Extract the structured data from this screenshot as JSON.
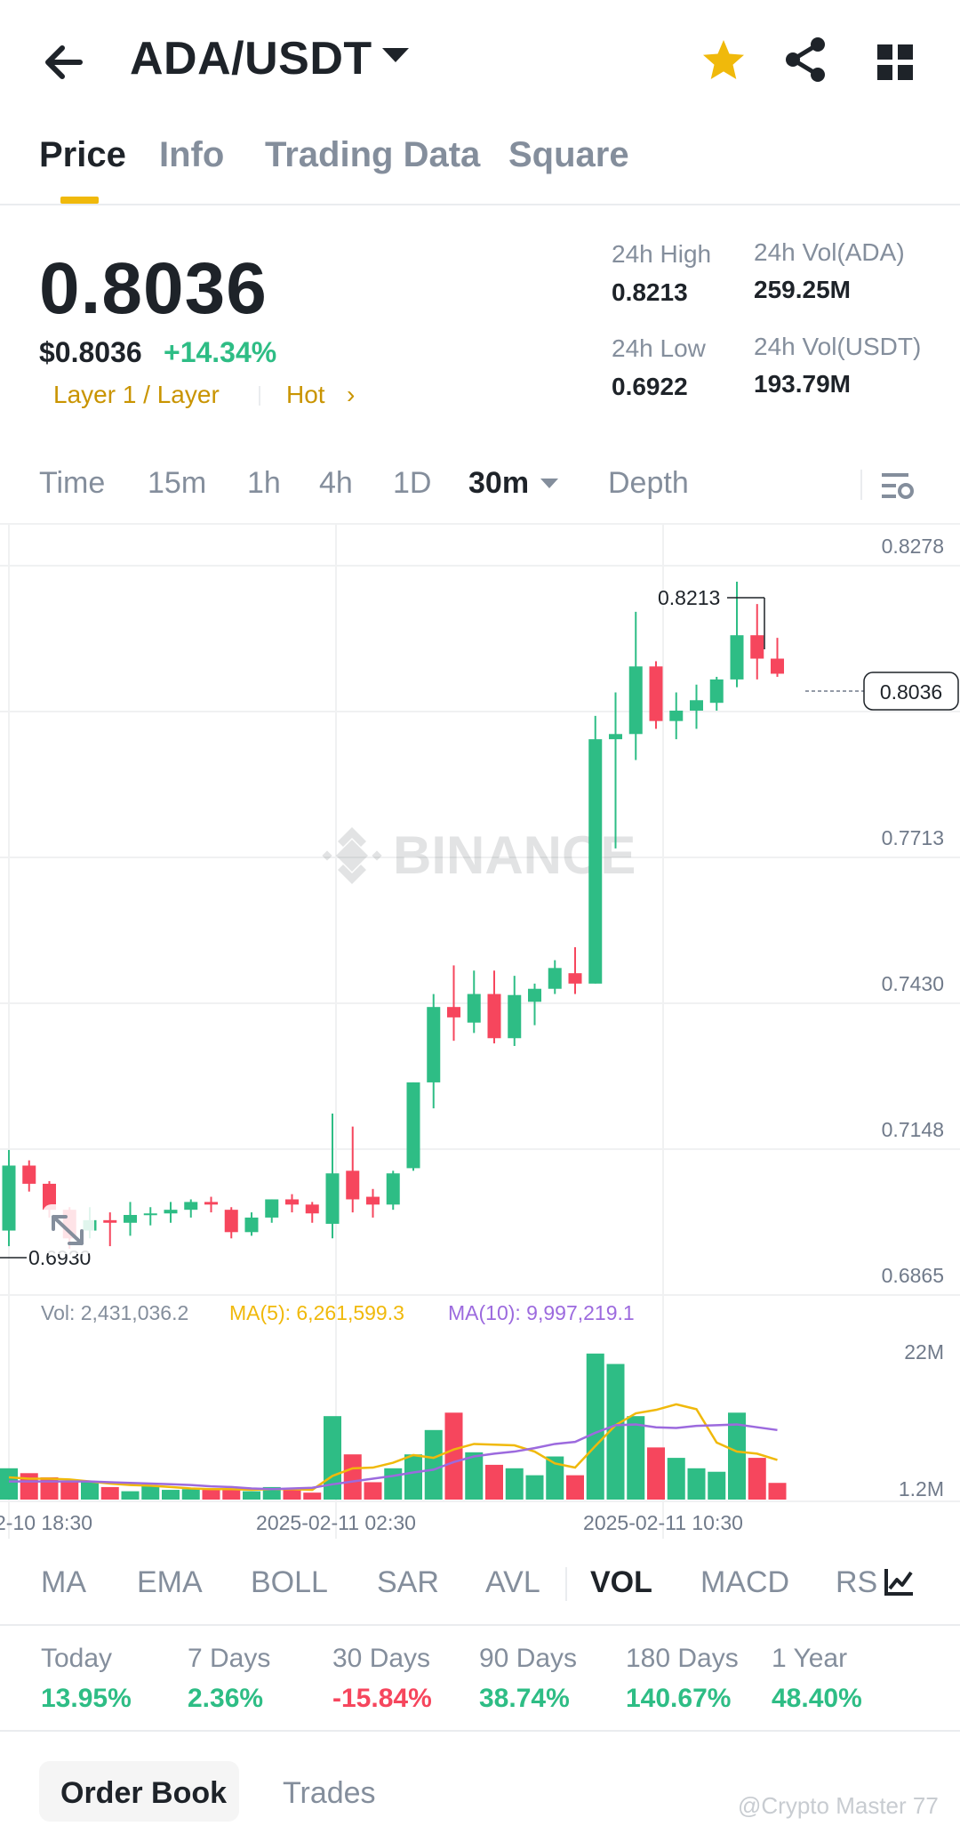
{
  "header": {
    "pair": "ADA/USDT"
  },
  "tabs": [
    "Price",
    "Info",
    "Trading Data",
    "Square"
  ],
  "price": {
    "last": "0.8036",
    "usd": "$0.8036",
    "change": "+14.34%",
    "tag_category": "Layer 1 / Layer",
    "tag_hot": "Hot",
    "tag_arrow": "›"
  },
  "stats": {
    "high_label": "24h High",
    "high": "0.8213",
    "low_label": "24h Low",
    "low": "0.6922",
    "vol_base_label": "24h Vol(ADA)",
    "vol_base": "259.25M",
    "vol_quote_label": "24h Vol(USDT)",
    "vol_quote": "193.79M"
  },
  "intervals": [
    "Time",
    "15m",
    "1h",
    "4h",
    "1D",
    "30m",
    "Depth"
  ],
  "chart": {
    "watermark": "BINANCE",
    "price_axis": [
      "0.8278",
      "0.7713",
      "0.7430",
      "0.7148",
      "0.6865"
    ],
    "current_price_tag": "0.8036",
    "high_marker": "0.8213",
    "low_marker": "0.6930",
    "vol_legend": {
      "vol": "Vol: 2,431,036.2",
      "ma5": "MA(5): 6,261,599.3",
      "ma10": "MA(10): 9,997,219.1"
    },
    "vol_axis": [
      "22M",
      "1.2M"
    ],
    "time_axis": [
      "2-10 18:30",
      "2025-02-11 02:30",
      "2025-02-11 10:30"
    ],
    "colors": {
      "up": "#2ebd85",
      "down": "#f6465d",
      "ma5": "#f0b90b",
      "ma10": "#9c6ade"
    }
  },
  "chart_data": {
    "type": "candlestick",
    "interval": "30m",
    "price_range": [
      0.6865,
      0.8278
    ],
    "candles": [
      {
        "o": 0.6965,
        "h": 0.712,
        "l": 0.6935,
        "c": 0.709
      },
      {
        "o": 0.709,
        "h": 0.71,
        "l": 0.704,
        "c": 0.7055
      },
      {
        "o": 0.7055,
        "h": 0.706,
        "l": 0.699,
        "c": 0.7005
      },
      {
        "o": 0.7005,
        "h": 0.701,
        "l": 0.693,
        "c": 0.695
      },
      {
        "o": 0.6965,
        "h": 0.701,
        "l": 0.695,
        "c": 0.6985
      },
      {
        "o": 0.6985,
        "h": 0.7,
        "l": 0.6935,
        "c": 0.698
      },
      {
        "o": 0.698,
        "h": 0.702,
        "l": 0.6955,
        "c": 0.6995
      },
      {
        "o": 0.6995,
        "h": 0.701,
        "l": 0.6975,
        "c": 0.6998
      },
      {
        "o": 0.6998,
        "h": 0.702,
        "l": 0.698,
        "c": 0.7005
      },
      {
        "o": 0.7005,
        "h": 0.7025,
        "l": 0.699,
        "c": 0.702
      },
      {
        "o": 0.702,
        "h": 0.703,
        "l": 0.7,
        "c": 0.7015
      },
      {
        "o": 0.7005,
        "h": 0.701,
        "l": 0.695,
        "c": 0.6962
      },
      {
        "o": 0.6962,
        "h": 0.7,
        "l": 0.6955,
        "c": 0.699
      },
      {
        "o": 0.699,
        "h": 0.7025,
        "l": 0.698,
        "c": 0.7025
      },
      {
        "o": 0.7025,
        "h": 0.7035,
        "l": 0.7,
        "c": 0.7015
      },
      {
        "o": 0.7015,
        "h": 0.702,
        "l": 0.698,
        "c": 0.6998
      },
      {
        "o": 0.6978,
        "h": 0.719,
        "l": 0.695,
        "c": 0.7075
      },
      {
        "o": 0.708,
        "h": 0.7165,
        "l": 0.7,
        "c": 0.7025
      },
      {
        "o": 0.703,
        "h": 0.7045,
        "l": 0.699,
        "c": 0.7015
      },
      {
        "o": 0.7015,
        "h": 0.708,
        "l": 0.7005,
        "c": 0.7075
      },
      {
        "o": 0.7085,
        "h": 0.725,
        "l": 0.708,
        "c": 0.725
      },
      {
        "o": 0.725,
        "h": 0.742,
        "l": 0.72,
        "c": 0.7395
      },
      {
        "o": 0.7395,
        "h": 0.7475,
        "l": 0.733,
        "c": 0.7375
      },
      {
        "o": 0.7365,
        "h": 0.7465,
        "l": 0.7345,
        "c": 0.742
      },
      {
        "o": 0.742,
        "h": 0.7465,
        "l": 0.7325,
        "c": 0.7335
      },
      {
        "o": 0.7335,
        "h": 0.7455,
        "l": 0.732,
        "c": 0.7418
      },
      {
        "o": 0.7405,
        "h": 0.744,
        "l": 0.736,
        "c": 0.743
      },
      {
        "o": 0.743,
        "h": 0.7485,
        "l": 0.742,
        "c": 0.747
      },
      {
        "o": 0.746,
        "h": 0.751,
        "l": 0.742,
        "c": 0.744
      },
      {
        "o": 0.744,
        "h": 0.7955,
        "l": 0.744,
        "c": 0.791
      },
      {
        "o": 0.791,
        "h": 0.8,
        "l": 0.77,
        "c": 0.792
      },
      {
        "o": 0.792,
        "h": 0.8155,
        "l": 0.787,
        "c": 0.805
      },
      {
        "o": 0.805,
        "h": 0.806,
        "l": 0.793,
        "c": 0.7945
      },
      {
        "o": 0.7945,
        "h": 0.8,
        "l": 0.791,
        "c": 0.7965
      },
      {
        "o": 0.7965,
        "h": 0.8015,
        "l": 0.793,
        "c": 0.7985
      },
      {
        "o": 0.798,
        "h": 0.803,
        "l": 0.7965,
        "c": 0.8025
      },
      {
        "o": 0.8025,
        "h": 0.8213,
        "l": 0.801,
        "c": 0.811
      },
      {
        "o": 0.811,
        "h": 0.817,
        "l": 0.8025,
        "c": 0.8065
      },
      {
        "o": 0.8065,
        "h": 0.8105,
        "l": 0.803,
        "c": 0.8036
      }
    ],
    "volume_range": [
      0,
      22000000
    ],
    "volumes": [
      4.5,
      3.8,
      3.2,
      2.6,
      2.5,
      1.8,
      1.2,
      2.0,
      1.4,
      1.5,
      1.4,
      1.5,
      1.2,
      1.8,
      1.4,
      1.0,
      12.0,
      6.5,
      2.5,
      4.5,
      6.5,
      10.0,
      12.5,
      6.8,
      5.0,
      4.5,
      3.5,
      6.2,
      3.5,
      21.0,
      19.5,
      12.0,
      7.5,
      6.0,
      4.5,
      4.0,
      12.5,
      6.0,
      2.4
    ],
    "ma5": [
      3.2,
      3.0,
      3.0,
      2.9,
      2.6,
      2.3,
      2.1,
      2.0,
      1.8,
      1.6,
      1.5,
      1.5,
      1.4,
      1.5,
      1.5,
      1.4,
      3.4,
      4.5,
      4.6,
      5.3,
      6.4,
      6.0,
      7.2,
      8.0,
      7.9,
      7.8,
      6.9,
      5.2,
      4.6,
      7.7,
      10.7,
      12.4,
      12.9,
      13.7,
      13.0,
      8.2,
      6.9,
      6.6,
      5.7
    ],
    "ma10": [
      2.6,
      2.6,
      2.6,
      2.6,
      2.6,
      2.5,
      2.4,
      2.3,
      2.2,
      2.1,
      1.9,
      1.8,
      1.6,
      1.5,
      1.6,
      1.7,
      2.2,
      2.6,
      3.0,
      3.4,
      3.9,
      4.3,
      5.4,
      6.2,
      6.6,
      6.9,
      7.4,
      8.0,
      8.3,
      9.6,
      10.7,
      10.8,
      10.4,
      10.3,
      10.6,
      10.7,
      10.8,
      10.4,
      10.0
    ],
    "volume_unit": "M"
  },
  "indicators": [
    "MA",
    "EMA",
    "BOLL",
    "SAR",
    "AVL",
    "VOL",
    "MACD",
    "RS"
  ],
  "performance": [
    {
      "label": "Today",
      "value": "13.95%",
      "dir": "up"
    },
    {
      "label": "7 Days",
      "value": "2.36%",
      "dir": "up"
    },
    {
      "label": "30 Days",
      "value": "-15.84%",
      "dir": "down"
    },
    {
      "label": "90 Days",
      "value": "38.74%",
      "dir": "up"
    },
    {
      "label": "180 Days",
      "value": "140.67%",
      "dir": "up"
    },
    {
      "label": "1 Year",
      "value": "48.40%",
      "dir": "up"
    }
  ],
  "bottom_tabs": {
    "orderbook": "Order Book",
    "trades": "Trades"
  },
  "watermark_user": "@Crypto Master 77",
  "icons": {
    "back": "arrow-left-icon",
    "star": "star-icon",
    "share": "share-icon",
    "grid": "grid-icon",
    "settings": "chart-settings-icon",
    "indicator": "indicator-icon"
  }
}
